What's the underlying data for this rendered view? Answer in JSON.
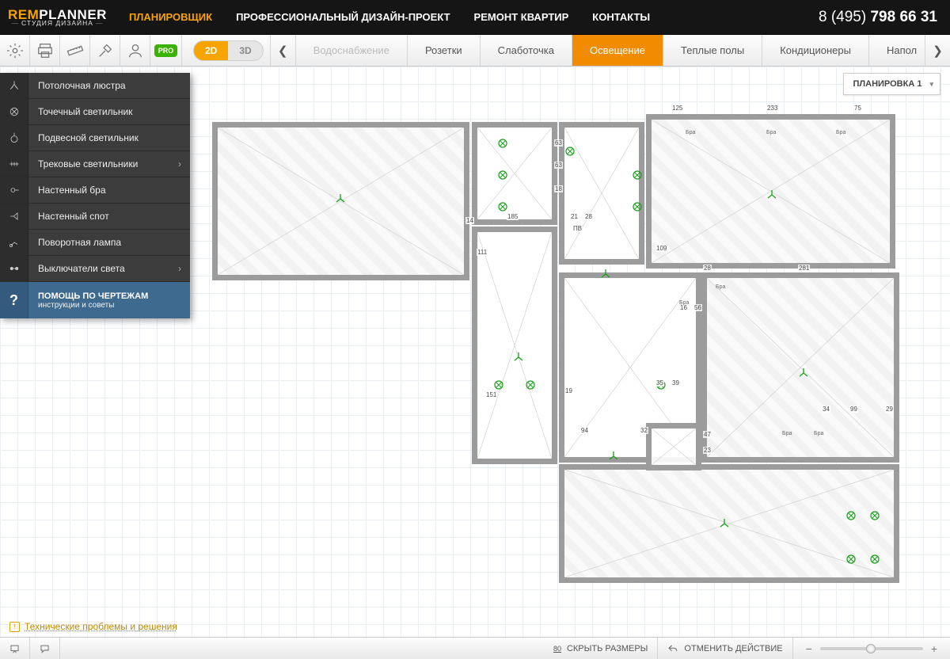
{
  "logo": {
    "part1": "REM",
    "part2": "PLANNER",
    "sub": "СТУДИЯ ДИЗАЙНА"
  },
  "nav": {
    "items": [
      "ПЛАНИРОВЩИК",
      "ПРОФЕССИОНАЛЬНЫЙ ДИЗАЙН-ПРОЕКТ",
      "РЕМОНТ КВАРТИР",
      "КОНТАКТЫ"
    ],
    "active_index": 0
  },
  "phone": {
    "prefix": "8 (495) ",
    "number": "798 66 31"
  },
  "toolbar": {
    "pro_badge": "PRO",
    "view2d": "2D",
    "view3d": "3D",
    "active_view": "2D",
    "tabs": [
      "Водоснабжение",
      "Розетки",
      "Слаботочка",
      "Освещение",
      "Теплые полы",
      "Кондиционеры",
      "Напол"
    ],
    "active_tab_index": 3
  },
  "side_tools": {
    "items": [
      {
        "label": "Потолочная люстра",
        "icon": "chandelier",
        "submenu": false
      },
      {
        "label": "Точечный светильник",
        "icon": "spotlight",
        "submenu": false
      },
      {
        "label": "Подвесной светильник",
        "icon": "pendant",
        "submenu": false
      },
      {
        "label": "Трековые светильники",
        "icon": "track",
        "submenu": true
      },
      {
        "label": "Настенный бра",
        "icon": "bra",
        "submenu": false
      },
      {
        "label": "Настенный спот",
        "icon": "wallspot",
        "submenu": false
      },
      {
        "label": "Поворотная лампа",
        "icon": "swivel",
        "submenu": false
      },
      {
        "label": "Выключатели света",
        "icon": "switch",
        "submenu": true
      }
    ],
    "help": {
      "title": "ПОМОЩЬ ПО ЧЕРТЕЖАМ",
      "sub": "инструкции и советы",
      "mark": "?"
    }
  },
  "layout_dropdown": {
    "label": "ПЛАНИРОВКА 1"
  },
  "dimensions": {
    "top_right": [
      "125",
      "233",
      "75"
    ],
    "bath": [
      "63",
      "63",
      "18"
    ],
    "bath_bottom": "185",
    "corridor_pair": [
      "21",
      "28"
    ],
    "label_pv": "ПВ",
    "left_room_right": "14",
    "hall_left": "111",
    "mid_right": "109",
    "right_pair": [
      "28",
      "281"
    ],
    "kitchen_pair": [
      "35",
      "39"
    ],
    "hall_num_151": "151",
    "hall_num_19": "19",
    "bottom_row": [
      "94",
      "32"
    ],
    "kitchen2": [
      "16",
      "56"
    ],
    "right_block": [
      "34",
      "99",
      "29"
    ],
    "right_block2": [
      "47",
      "23"
    ]
  },
  "bra_label": "Бра",
  "warning_link": "Технические проблемы и решения",
  "statusbar": {
    "hide_dims_num": "80",
    "hide_dims": "СКРЫТЬ РАЗМЕРЫ",
    "undo": "ОТМЕНИТЬ ДЕЙСТВИЕ"
  },
  "colors": {
    "accent": "#f7a300",
    "tab_active": "#f18c00",
    "pro": "#3bb100",
    "help": "#3e6a8f"
  }
}
